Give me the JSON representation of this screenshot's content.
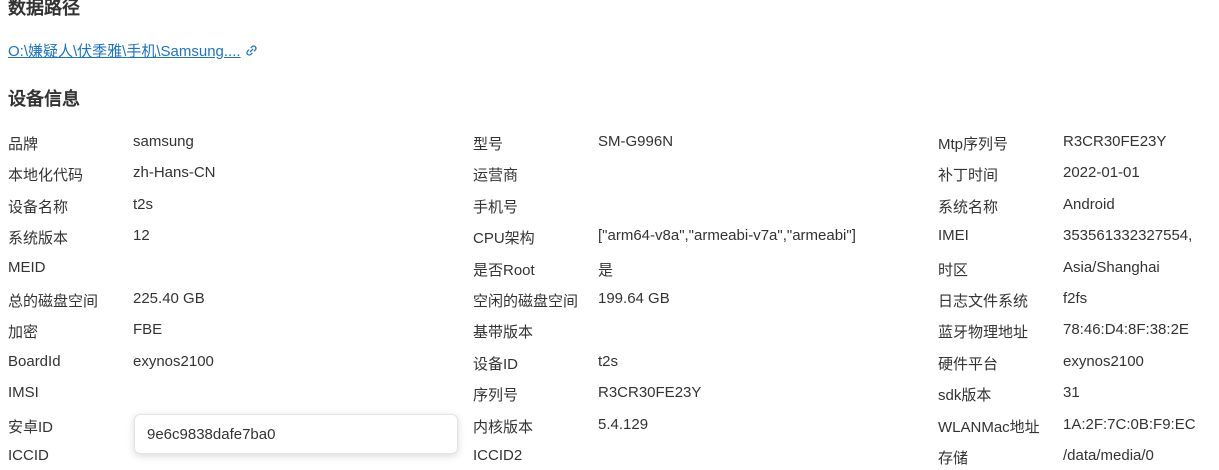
{
  "data_path": {
    "title": "数据路径",
    "link_text": "O:\\嫌疑人\\伏季雅\\手机\\Samsung....",
    "link_icon": "link-icon"
  },
  "device_info": {
    "title": "设备信息",
    "rows": [
      [
        [
          "品牌",
          "samsung"
        ],
        [
          "型号",
          "SM-G996N"
        ],
        [
          "Mtp序列号",
          "R3CR30FE23Y"
        ]
      ],
      [
        [
          "本地化代码",
          "zh-Hans-CN"
        ],
        [
          "运营商",
          ""
        ],
        [
          "补丁时间",
          "2022-01-01"
        ]
      ],
      [
        [
          "设备名称",
          "t2s"
        ],
        [
          "手机号",
          ""
        ],
        [
          "系统名称",
          "Android"
        ]
      ],
      [
        [
          "系统版本",
          "12"
        ],
        [
          "CPU架构",
          "[\"arm64-v8a\",\"armeabi-v7a\",\"armeabi\"]"
        ],
        [
          "IMEI",
          "353561332327554,"
        ]
      ],
      [
        [
          "MEID",
          ""
        ],
        [
          "是否Root",
          "是"
        ],
        [
          "时区",
          "Asia/Shanghai"
        ]
      ],
      [
        [
          "总的磁盘空间",
          "225.40 GB"
        ],
        [
          "空闲的磁盘空间",
          "199.64 GB"
        ],
        [
          "日志文件系统",
          "f2fs"
        ]
      ],
      [
        [
          "加密",
          "FBE"
        ],
        [
          "基带版本",
          ""
        ],
        [
          "蓝牙物理地址",
          "78:46:D4:8F:38:2E"
        ]
      ],
      [
        [
          "BoardId",
          "exynos2100"
        ],
        [
          "设备ID",
          "t2s"
        ],
        [
          "硬件平台",
          "exynos2100"
        ]
      ],
      [
        [
          "IMSI",
          ""
        ],
        [
          "序列号",
          "R3CR30FE23Y"
        ],
        [
          "sdk版本",
          "31"
        ]
      ],
      [
        [
          "安卓ID",
          ""
        ],
        [
          "内核版本",
          "5.4.129"
        ],
        [
          "WLANMac地址",
          "1A:2F:7C:0B:F9:EC"
        ]
      ],
      [
        [
          "ICCID",
          ""
        ],
        [
          "ICCID2",
          ""
        ],
        [
          "存储",
          "/data/media/0"
        ]
      ]
    ]
  },
  "tooltip": {
    "text": "9e6c9838dafe7ba0"
  },
  "colors": {
    "link": "#1a73c8",
    "text": "#333333"
  }
}
